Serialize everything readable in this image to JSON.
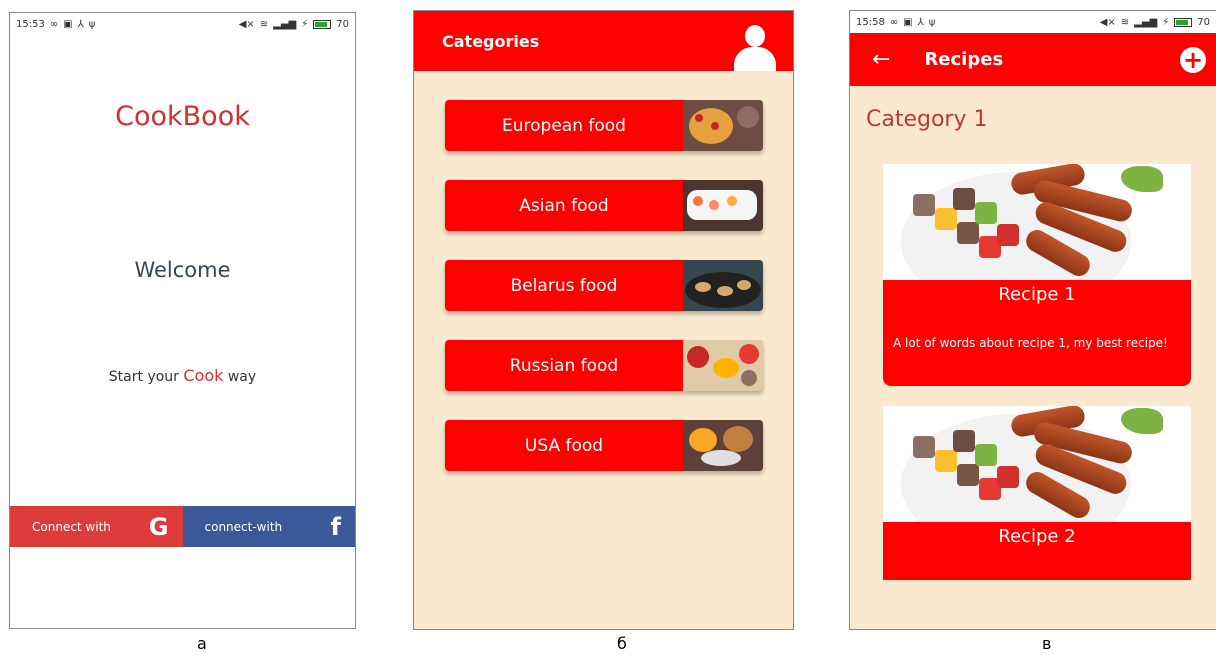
{
  "screen_a": {
    "status": {
      "time": "15:53",
      "battery": "70"
    },
    "app_title": "CookBook",
    "welcome": "Welcome",
    "start_prefix": "Start your",
    "start_highlight": "Cook",
    "start_suffix": "way",
    "connect_google": "Connect with",
    "connect_google_icon": "G",
    "connect_facebook": "connect-with",
    "connect_facebook_icon": "f",
    "caption": "а"
  },
  "screen_b": {
    "title": "Categories",
    "categories": [
      {
        "label": "European food"
      },
      {
        "label": "Asian food"
      },
      {
        "label": "Belarus food"
      },
      {
        "label": "Russian food"
      },
      {
        "label": "USA food"
      }
    ],
    "caption": "б"
  },
  "screen_c": {
    "status": {
      "time": "15:58",
      "battery": "70"
    },
    "title": "Recipes",
    "back_icon": "←",
    "add_icon": "+",
    "category": "Category 1",
    "recipes": [
      {
        "name": "Recipe 1",
        "description": "A lot of words about recipe 1, my best recipe!"
      },
      {
        "name": "Recipe 2"
      }
    ],
    "caption": "в"
  },
  "colors": {
    "primary": "#ff0000",
    "accent_text": "#d32f2f",
    "background": "#fbe9cf",
    "facebook": "#3b5998",
    "google": "#dd3a3a"
  }
}
